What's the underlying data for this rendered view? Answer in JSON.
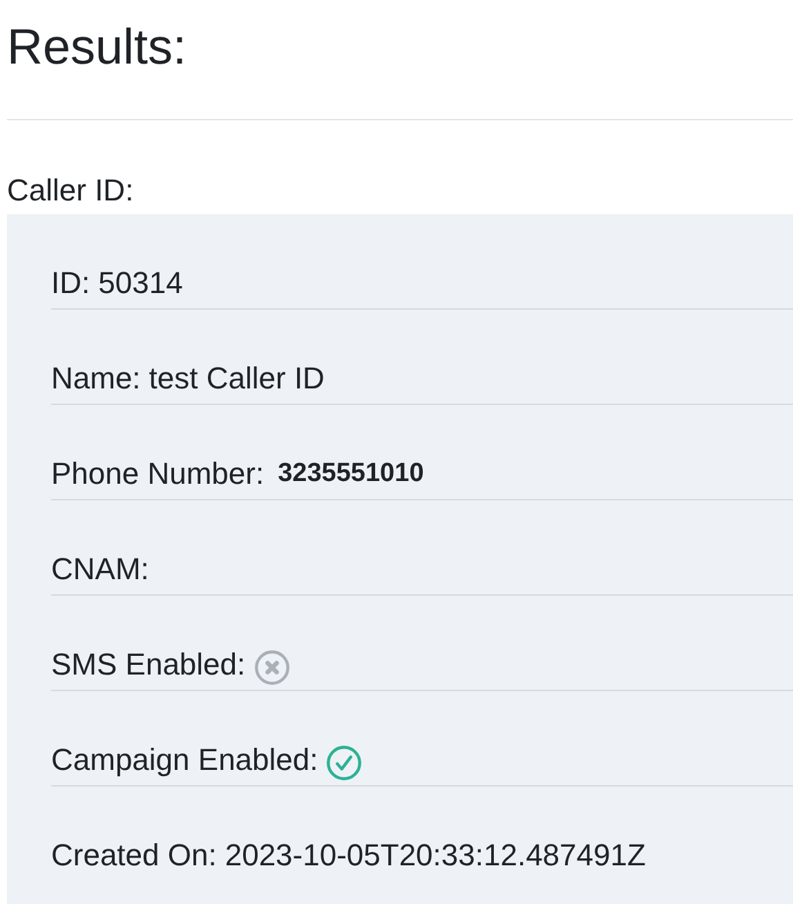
{
  "title": "Results:",
  "section_label": "Caller ID:",
  "fields": [
    {
      "kind": "text",
      "label": "ID:",
      "value": "50314"
    },
    {
      "kind": "text",
      "label": "Name:",
      "value": "test Caller ID"
    },
    {
      "kind": "phone",
      "label": "Phone Number:",
      "value": "3235551010"
    },
    {
      "kind": "text",
      "label": "CNAM:"
    },
    {
      "kind": "flag",
      "label": "SMS Enabled:",
      "on": false
    },
    {
      "kind": "flag",
      "label": "Campaign Enabled:",
      "on": true
    },
    {
      "kind": "text",
      "label": "Created On:",
      "value": "2023-10-05T20:33:12.487491Z"
    }
  ]
}
